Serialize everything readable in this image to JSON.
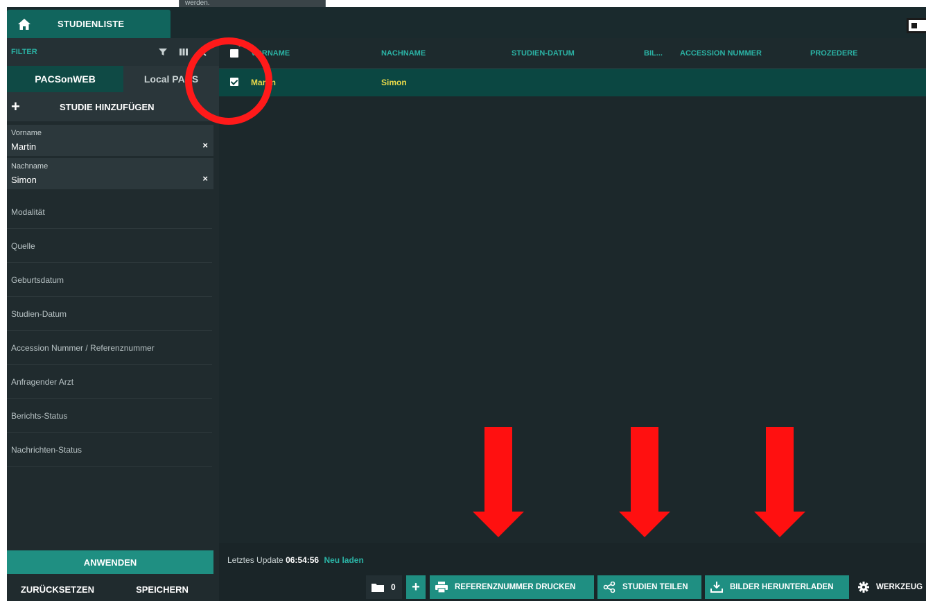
{
  "tooltip_fragment": "werden.",
  "header": {
    "tab_label": "STUDIENLISTE"
  },
  "sidebar": {
    "filter_title": "FILTER",
    "source_tabs": [
      "PACSonWEB",
      "Local PACS"
    ],
    "add_study_label": "STUDIE HINZUFÜGEN",
    "fields": [
      {
        "label": "Vorname",
        "value": "Martin",
        "clear": "×"
      },
      {
        "label": "Nachname",
        "value": "Simon",
        "clear": "×"
      }
    ],
    "filters": [
      "Modalität",
      "Quelle",
      "Geburtsdatum",
      "Studien-Datum",
      "Accession Nummer / Referenznummer",
      "Anfragender Arzt",
      "Berichts-Status",
      "Nachrichten-Status"
    ],
    "apply_label": "ANWENDEN",
    "reset_label": "ZURÜCKSETZEN",
    "save_label": "SPEICHERN"
  },
  "table": {
    "selected_count": "1",
    "columns": [
      "VORNAME",
      "NACHNAME",
      "STUDIEN-DATUM",
      "BIL...",
      "ACCESSION NUMMER",
      "PROZEDERE"
    ],
    "rows": [
      {
        "vorname": "Martin",
        "nachname": "Simon",
        "checked": true
      }
    ]
  },
  "footer": {
    "update_prefix": "Letztes Update",
    "update_time": "06:54:56",
    "reload_label": "Neu laden",
    "folder_count": "0",
    "plus_label": "+",
    "print_ref_label": "REFERENZNUMMER DRUCKEN",
    "share_label": "STUDIEN TEILEN",
    "download_label": "BILDER HERUNTERLADEN",
    "tools_label": "WERKZEUG"
  },
  "colors": {
    "accent": "#1f8f82",
    "accent_text": "#2bb3a5",
    "selected_row": "#0b4742",
    "row_text": "#e8d94a",
    "annotation_red": "#ff0000"
  },
  "icons": [
    "home-icon",
    "filter-icon",
    "columns-icon",
    "chevron-left-icon",
    "plus-icon",
    "folder-icon",
    "print-icon",
    "share-icon",
    "download-icon",
    "gear-icon"
  ]
}
